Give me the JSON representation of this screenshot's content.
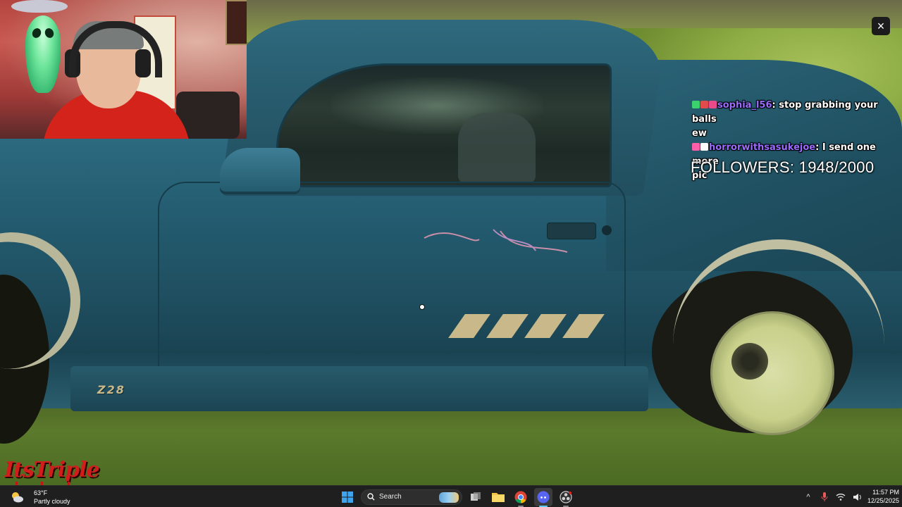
{
  "overlay": {
    "close_label": "×",
    "chat": [
      {
        "username": "sophia_l56",
        "message": ": stop grabbing your balls",
        "badge_colors": [
          "#3bd16f",
          "#e04b4b",
          "#e94a8a"
        ]
      },
      {
        "username": "",
        "message": "ew",
        "badge_colors": []
      },
      {
        "username": "horrorwithsasukejoe",
        "message": ": I send one more",
        "badge_colors": [
          "#ff5ea8",
          "#ffffff"
        ]
      },
      {
        "username": "",
        "message": "pic",
        "badge_colors": []
      }
    ],
    "followers_text": "FOLLOWERS: 1948/2000",
    "logo_text": "ItsTriple",
    "car_badge_text": "Z28"
  },
  "taskbar": {
    "weather": {
      "temp": "63°F",
      "condition": "Partly cloudy",
      "icon": "partly-cloudy-icon"
    },
    "search_label": "Search",
    "pinned": [
      {
        "name": "start",
        "icon": "windows-start-icon"
      },
      {
        "name": "task-view",
        "icon": "task-view-icon"
      },
      {
        "name": "file-explorer",
        "icon": "folder-icon"
      },
      {
        "name": "chrome",
        "icon": "chrome-icon"
      },
      {
        "name": "discord",
        "icon": "discord-icon"
      },
      {
        "name": "obs",
        "icon": "obs-icon"
      }
    ],
    "tray": {
      "chevron": "^",
      "mic": "🎙",
      "wifi": "wifi-icon",
      "volume": "volume-icon"
    },
    "clock": {
      "time": "11:57 PM",
      "date": "12/25/2025"
    }
  },
  "colors": {
    "accent": "#9b6bff",
    "logo": "#d21d1d",
    "taskbar_bg": "#1f1f1f"
  }
}
